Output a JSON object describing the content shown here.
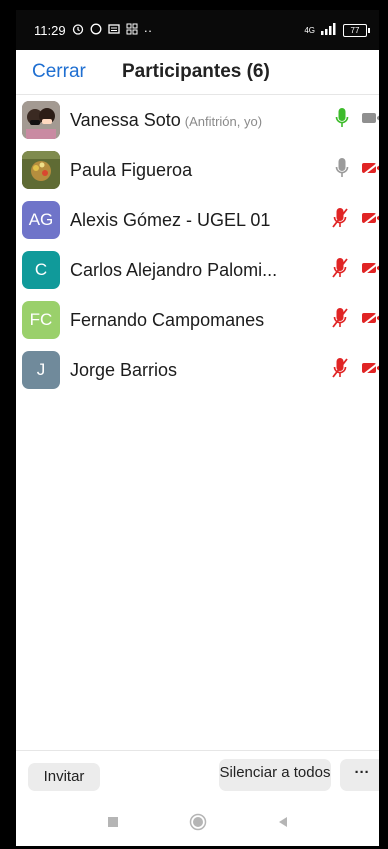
{
  "status_bar": {
    "time": "11:29",
    "network_label": "4G",
    "battery_level": "77"
  },
  "header": {
    "close_label": "Cerrar",
    "title": "Participantes (6)"
  },
  "participants": [
    {
      "name": "Vanessa Soto",
      "note": "(Anfitrión, yo)",
      "avatar_initials": "",
      "avatar_color": "#8a7f7c",
      "mic": "on",
      "video": "on"
    },
    {
      "name": "Paula Figueroa",
      "note": "",
      "avatar_initials": "",
      "avatar_color": "#7a6a3a",
      "mic": "idle",
      "video": "off"
    },
    {
      "name": "Alexis Gómez - UGEL 01",
      "note": "",
      "avatar_initials": "AG",
      "avatar_color": "#6f74c9",
      "mic": "muted",
      "video": "off"
    },
    {
      "name": "Carlos Alejandro Palomi...",
      "note": "",
      "avatar_initials": "C",
      "avatar_color": "#109a9a",
      "mic": "muted",
      "video": "off"
    },
    {
      "name": "Fernando Campomanes",
      "note": "",
      "avatar_initials": "FC",
      "avatar_color": "#9ad06b",
      "mic": "muted",
      "video": "off"
    },
    {
      "name": "Jorge Barrios",
      "note": "",
      "avatar_initials": "J",
      "avatar_color": "#708a9b",
      "mic": "muted",
      "video": "off"
    }
  ],
  "bottom_bar": {
    "invite_label": "Invitar",
    "mute_all_label": "Silenciar a todos",
    "more_label": "···"
  },
  "colors": {
    "accent": "#1f6fd1",
    "mic_active": "#3dbb2b",
    "muted_red": "#e02424",
    "icon_gray": "#9a9a9a"
  }
}
